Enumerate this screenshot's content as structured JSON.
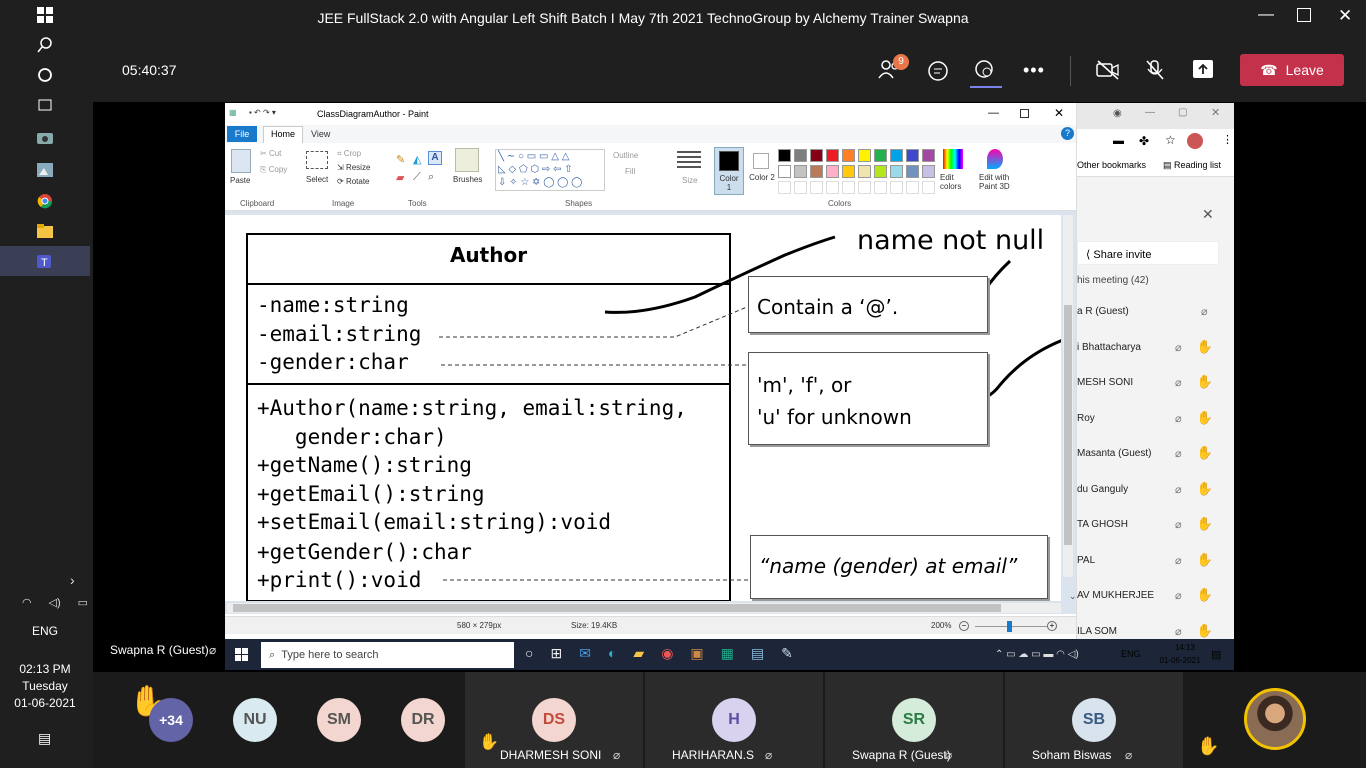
{
  "os_sidebar": {
    "language": "ENG",
    "time": "02:13 PM",
    "day": "Tuesday",
    "date": "01-06-2021"
  },
  "meeting": {
    "title": "JEE FullStack 2.0 with Angular Left Shift Batch I May 7th 2021 TechnoGroup by Alchemy Trainer Swapna",
    "elapsed": "05:40:37",
    "participants_badge": "9",
    "leave_label": "Leave"
  },
  "paint": {
    "title": "ClassDiagramAuthor - Paint",
    "tabs": [
      "File",
      "Home",
      "View"
    ],
    "clipboard": {
      "paste": "Paste",
      "cut": "Cut",
      "copy": "Copy",
      "label": "Clipboard"
    },
    "image": {
      "select": "Select",
      "crop": "Crop",
      "resize": "Resize",
      "rotate": "Rotate",
      "label": "Image"
    },
    "tools": {
      "label": "Tools"
    },
    "brushes": "Brushes",
    "shapes": {
      "outline": "Outline",
      "fill": "Fill",
      "label": "Shapes"
    },
    "size": "Size",
    "color1": "Color 1",
    "color2": "Color 2",
    "colors_label": "Colors",
    "edit_colors": "Edit colors",
    "edit_3d": "Edit with Paint 3D",
    "palette": [
      "#000000",
      "#7f7f7f",
      "#880015",
      "#ed1c24",
      "#ff7f27",
      "#fff200",
      "#22b14c",
      "#00a2e8",
      "#3f48cc",
      "#a349a4",
      "#ffffff",
      "#c3c3c3",
      "#b97a57",
      "#ffaec9",
      "#ffc90e",
      "#efe4b0",
      "#b5e61d",
      "#99d9ea",
      "#7092be",
      "#c8bfe7"
    ],
    "status": {
      "dims": "580 × 279px",
      "size": "Size: 19.4KB",
      "zoom": "200%"
    }
  },
  "uml": {
    "class_name": "Author",
    "attributes": [
      "-name:string",
      "-email:string",
      "-gender:char"
    ],
    "methods": [
      "+Author(name:string, email:string,",
      "   gender:char)",
      "+getName():string",
      "+getEmail():string",
      "+setEmail(email:string):void",
      "+getGender():char",
      "+print():void"
    ],
    "note_email": "Contain a ‘@’.",
    "note_gender_1": "'m', 'f', or",
    "note_gender_2": "'u' for unknown",
    "note_print": "“name (gender) at email”",
    "handwritten": "name not null"
  },
  "win_taskbar": {
    "search_placeholder": "Type here to search",
    "lang": "ENG",
    "time": "14:13",
    "date": "01-06-2021"
  },
  "chrome": {
    "other_bookmarks": "Other bookmarks",
    "reading_list": "Reading list",
    "share_invite": "Share invite",
    "in_meeting": "his meeting (42)",
    "participants": [
      "a R (Guest)",
      "i Bhattacharya",
      "MESH SONI",
      "Roy",
      "Masanta (Guest)",
      "du Ganguly",
      "TA GHOSH",
      "PAL",
      "AV MUKHERJEE",
      "ILA SOM"
    ]
  },
  "presenter": "Swapna R (Guest)",
  "bottom": {
    "more_count": "+34",
    "tiles": [
      {
        "initials": "NU",
        "color": "#d9ebf0"
      },
      {
        "initials": "SM",
        "color": "#f3d6cf"
      },
      {
        "initials": "DR",
        "color": "#f3d6cf"
      }
    ],
    "video_tiles": [
      {
        "initials": "DS",
        "name": "DHARMESH SONI",
        "color": "#f3d6cf",
        "fg": "#c24a3a"
      },
      {
        "initials": "H",
        "name": "HARIHARAN.S",
        "color": "#d8d2ee",
        "fg": "#5a4fa0"
      },
      {
        "initials": "SR",
        "name": "Swapna R (Guest)",
        "color": "#d4ecd9",
        "fg": "#2c7a44"
      },
      {
        "initials": "SB",
        "name": "Soham Biswas",
        "color": "#d9e3ee",
        "fg": "#3a5a80"
      }
    ]
  }
}
